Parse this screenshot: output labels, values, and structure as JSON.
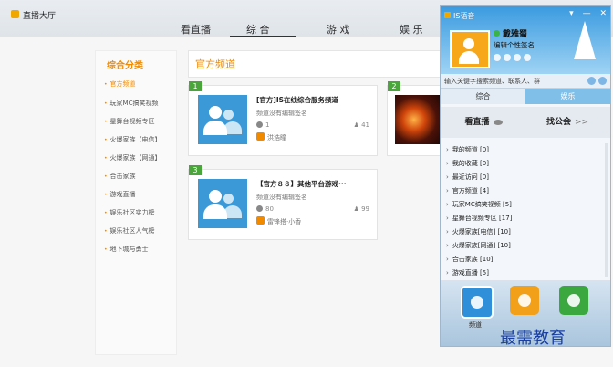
{
  "window": {
    "title": "直播大厅"
  },
  "topnav": {
    "items": [
      "看直播",
      "综 合",
      "游 戏",
      "娱 乐"
    ],
    "active_index": 1
  },
  "sidebar": {
    "heading": "综合分类",
    "items": [
      "官方频道",
      "玩家MC搞笑视频",
      "星舞台视频专区",
      "火爆家族【电信】",
      "火爆家族【网通】",
      "合击家族",
      "游戏直播",
      "娱乐社区实力榜",
      "娱乐社区人气榜",
      "地下城与勇士"
    ],
    "active_index": 0
  },
  "main": {
    "section_title": "官方频道",
    "cards": [
      {
        "num": "1",
        "title": "[官方]IS在线综合服务频道",
        "subtitle": "频道没有编辑签名",
        "count": "1",
        "users": "41",
        "host": "洪浩瞳"
      },
      {
        "num": "3",
        "title": "【官方８８】其他平台游戏···",
        "subtitle": "频道没有编辑签名",
        "count": "80",
        "users": "99",
        "host": "雷锋搭·小香"
      }
    ],
    "card2_num": "2"
  },
  "panel": {
    "title": "IS语音",
    "window_buttons": [
      "▾",
      "—",
      "✕"
    ],
    "username": "戴雅蜀",
    "signature": "编辑个性签名",
    "search_placeholder": "输入关键字搜索频道、联系人、群",
    "tabs": [
      "综合",
      "娱乐"
    ],
    "watch_btn": "看直播",
    "find_btn": "找公会",
    "find_arrow": ">>",
    "list": [
      "我的频道 [0]",
      "我的收藏 [0]",
      "最近访问 [0]",
      "官方频道 [4]",
      "玩家MC搞笑视频 [5]",
      "星舞台视频专区 [17]",
      "火爆家族[电信] [10]",
      "火爆家族[网通] [10]",
      "合击家族 [10]",
      "游戏直播 [5]"
    ],
    "dock": [
      "频道",
      "",
      ""
    ]
  },
  "watermark": "最需教育",
  "colors": {
    "accent_orange": "#f08a00",
    "card_badge_green": "#4aa53b",
    "panel_blue": "#3b9be0"
  }
}
